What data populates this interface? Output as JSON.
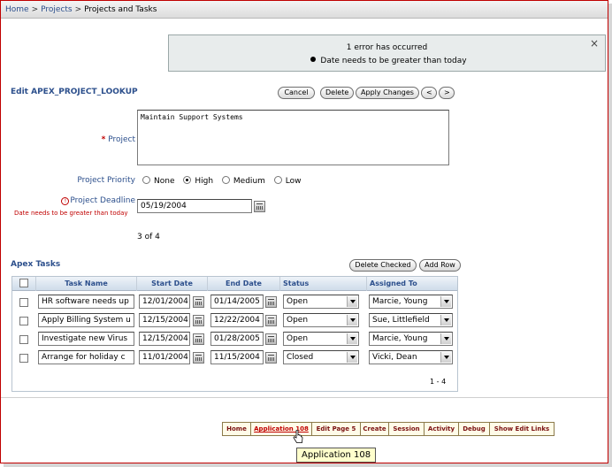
{
  "breadcrumb": {
    "home": "Home",
    "projects": "Projects",
    "current": "Projects and Tasks",
    "sep": ">"
  },
  "error": {
    "title": "1 error has occurred",
    "message": "Date needs to be greater than today",
    "close": "×"
  },
  "form": {
    "title": "Edit APEX_PROJECT_LOOKUP",
    "buttons": {
      "cancel": "Cancel",
      "delete": "Delete",
      "apply": "Apply Changes",
      "prev": "<",
      "next": ">"
    },
    "project_label": "Project",
    "project_value": "Maintain Support Systems",
    "priority_label": "Project Priority",
    "priority_options": [
      "None",
      "High",
      "Medium",
      "Low"
    ],
    "priority_selected": "High",
    "deadline_label": "Project Deadline",
    "deadline_value": "05/19/2004",
    "deadline_error": "Date needs to be greater than today",
    "record_counter": "3 of 4"
  },
  "tasks": {
    "title": "Apex Tasks",
    "buttons": {
      "delete_checked": "Delete Checked",
      "add_row": "Add Row"
    },
    "columns": [
      "Task Name",
      "Start Date",
      "End Date",
      "Status",
      "Assigned To"
    ],
    "rows": [
      {
        "task": "HR software needs up",
        "start": "12/01/2004",
        "end": "01/14/2005",
        "status": "Open",
        "assigned": "Marcie, Young"
      },
      {
        "task": "Apply Billing System u",
        "start": "12/15/2004",
        "end": "12/22/2004",
        "status": "Open",
        "assigned": "Sue, Littlefield"
      },
      {
        "task": "Investigate new Virus",
        "start": "12/15/2004",
        "end": "01/28/2005",
        "status": "Open",
        "assigned": "Marcie, Young"
      },
      {
        "task": "Arrange for holiday c",
        "start": "11/01/2004",
        "end": "11/15/2004",
        "status": "Closed",
        "assigned": "Vicki, Dean"
      }
    ],
    "pagination": "1 - 4"
  },
  "devbar": {
    "items": [
      "Home",
      "Application 108",
      "Edit Page 5",
      "Create",
      "Session",
      "Activity",
      "Debug",
      "Show Edit Links"
    ],
    "tooltip": "Application 108"
  },
  "colors": {
    "accent": "#2c4f8c",
    "error": "#c00000"
  }
}
